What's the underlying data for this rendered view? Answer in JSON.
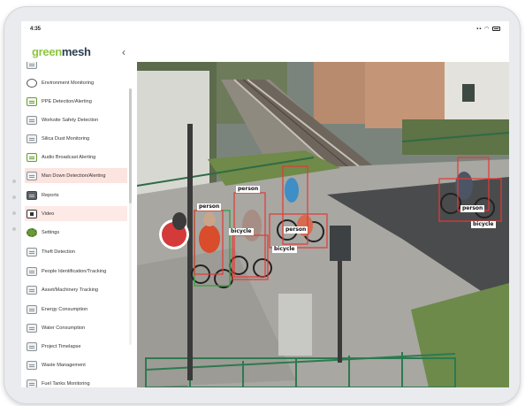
{
  "status_bar": {
    "time": "4:35",
    "icons": [
      "signal-icon",
      "wifi-icon",
      "battery-icon"
    ]
  },
  "app": {
    "logo_part1": "green",
    "logo_part2": "mesh",
    "collapse_label": "‹",
    "brand_green": "#8dc63f",
    "brand_dark": "#2c3e50",
    "active_highlight": "#fce4e0"
  },
  "sidebar": {
    "items": [
      {
        "label": "",
        "icon": "module-icon"
      },
      {
        "label": "Environment Monitoring",
        "icon": "environment-icon"
      },
      {
        "label": "PPE Detection/Alerting",
        "icon": "ppe-icon"
      },
      {
        "label": "Worksite Safety Detection",
        "icon": "safety-icon"
      },
      {
        "label": "Silica Dust Monitoring",
        "icon": "dust-icon"
      },
      {
        "label": "Audio Broadcast Alerting",
        "icon": "audio-icon"
      },
      {
        "label": "Man Down Detection/Alerting",
        "icon": "man-down-icon",
        "state": "active"
      },
      {
        "label": "Reports",
        "icon": "reports-icon"
      },
      {
        "label": "Video",
        "icon": "video-icon",
        "state": "selected"
      },
      {
        "label": "Settings",
        "icon": "settings-icon"
      },
      {
        "label": "Theft Detection",
        "icon": "theft-icon"
      },
      {
        "label": "People Identification/Tracking",
        "icon": "people-icon"
      },
      {
        "label": "Asset/Machinery Tracking",
        "icon": "asset-icon"
      },
      {
        "label": "Energy Consumption",
        "icon": "energy-icon"
      },
      {
        "label": "Water Consumption",
        "icon": "water-icon"
      },
      {
        "label": "Project Timelapse",
        "icon": "timelapse-icon"
      },
      {
        "label": "Waste Management",
        "icon": "waste-icon"
      },
      {
        "label": "Fuel Tanks Monitoring",
        "icon": "fuel-icon"
      }
    ]
  },
  "video": {
    "detections": [
      {
        "label": "person",
        "color": "#e53935"
      },
      {
        "label": "person",
        "color": "#e53935"
      },
      {
        "label": "bicycle",
        "color": "#43a047"
      },
      {
        "label": "person",
        "color": "#e53935"
      },
      {
        "label": "bicycle",
        "color": "#e53935"
      },
      {
        "label": "person",
        "color": "#e53935"
      },
      {
        "label": "bicycle",
        "color": "#e53935"
      }
    ]
  }
}
